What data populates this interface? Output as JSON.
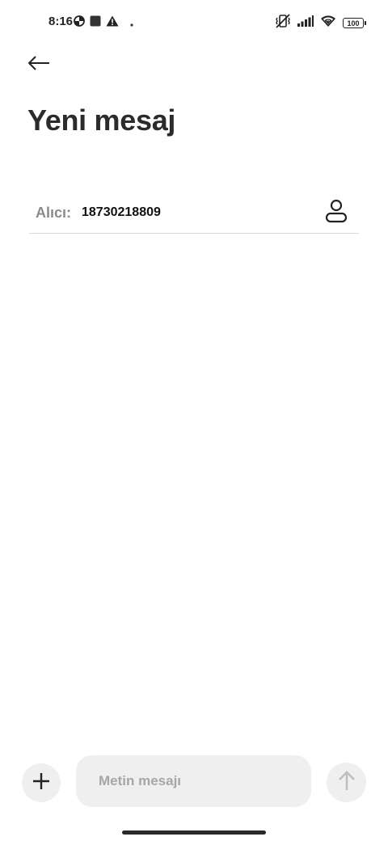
{
  "status_bar": {
    "time": "8:16",
    "battery_level": "100",
    "left_icons": [
      "data-saver-icon",
      "square-notification-icon",
      "warning-icon",
      "dot-icon"
    ],
    "right_icons": [
      "vibrate-off-icon",
      "cellular-signal-icon",
      "wifi-icon",
      "battery-icon"
    ]
  },
  "header": {
    "back_icon": "arrow-left-icon",
    "title": "Yeni mesaj"
  },
  "recipient": {
    "label": "Alıcı:",
    "value": "18730218809",
    "contact_icon": "contact-person-icon"
  },
  "composer": {
    "attach_icon": "plus-icon",
    "placeholder": "Metin mesajı",
    "send_icon": "arrow-up-icon"
  },
  "colors": {
    "background": "#ffffff",
    "input_background": "#efefef",
    "text_primary": "#222222",
    "text_secondary": "#8a8a8a",
    "divider": "#d9d9d9"
  }
}
